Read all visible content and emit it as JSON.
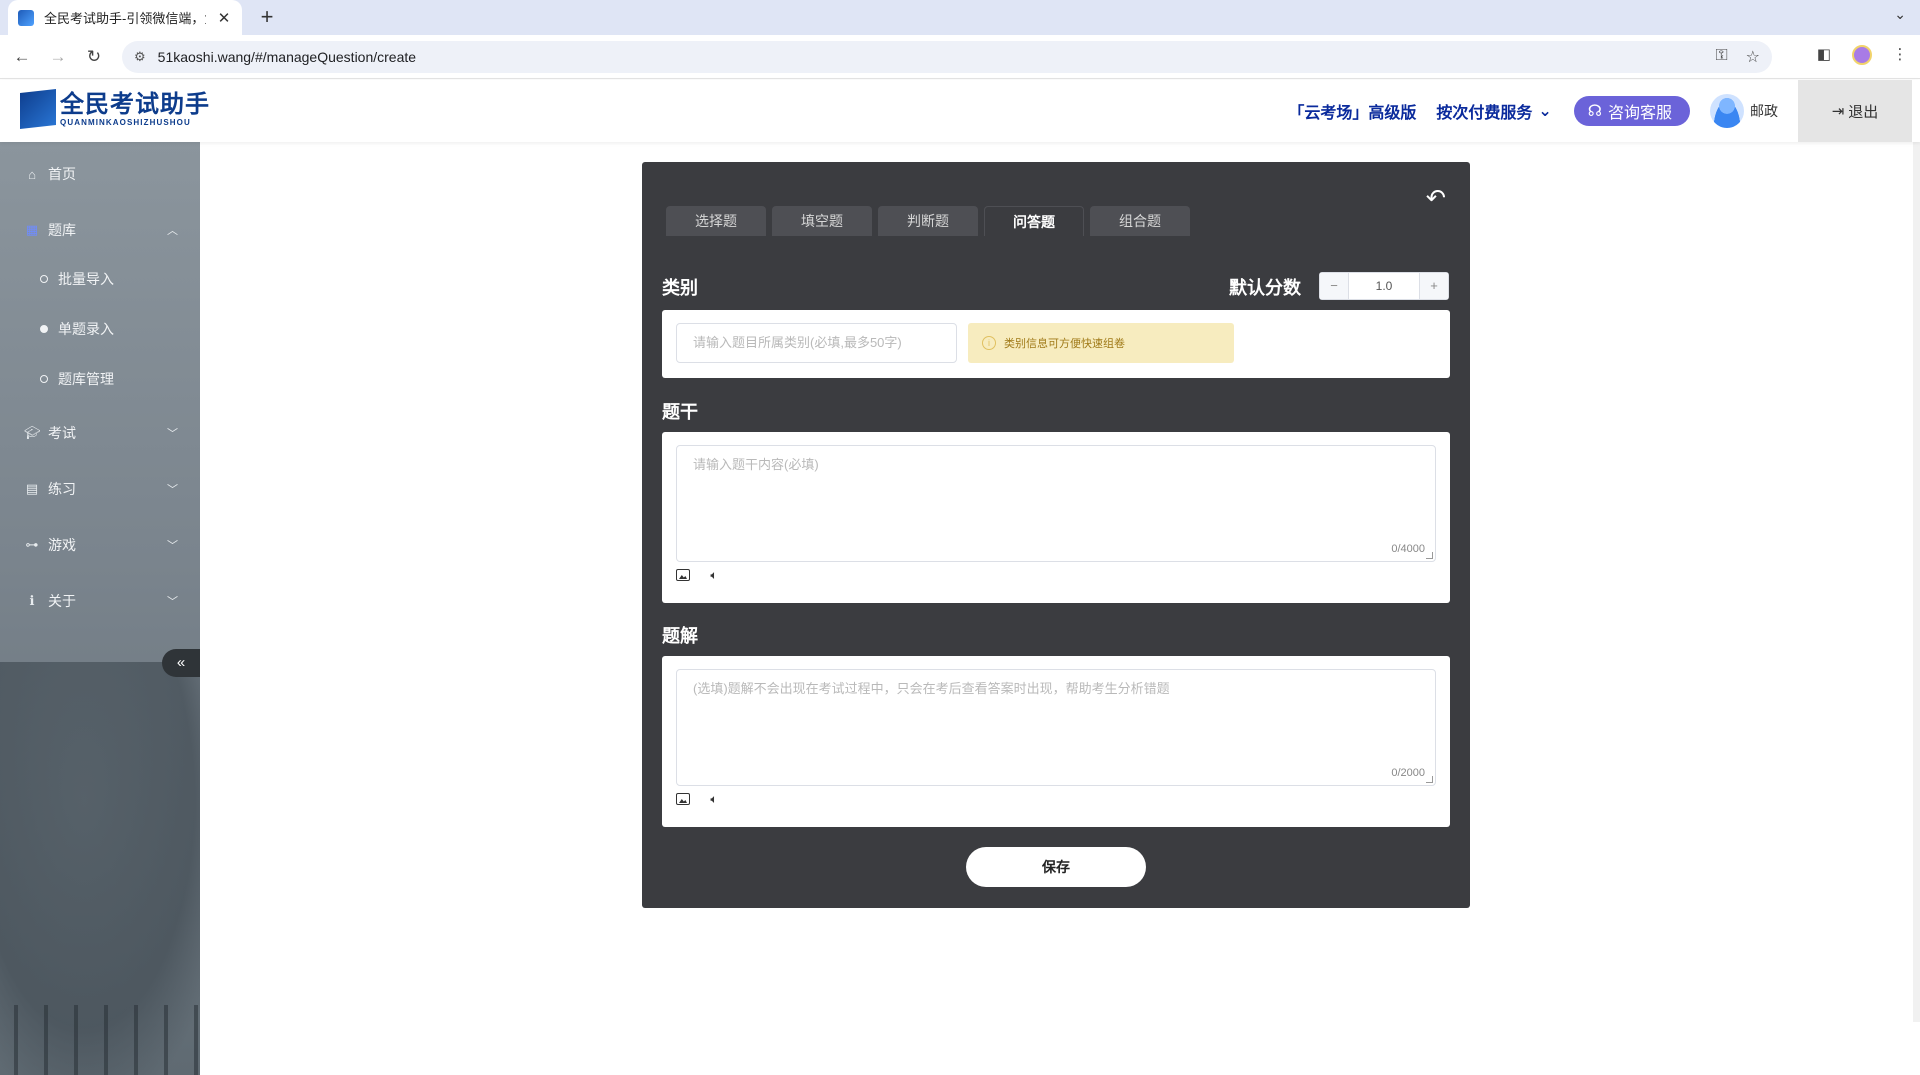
{
  "browser": {
    "tab_title": "全民考试助手-引领微信端，免费",
    "url": "51kaoshi.wang/#/manageQuestion/create"
  },
  "header": {
    "logo_cn": "全民考试助手",
    "logo_en": "QUANMINKAOSHIZHUSHOU",
    "premium": "「云考场」高级版",
    "pay_service": "按次付费服务",
    "consult": "咨询客服",
    "username": "邮政",
    "logout": "退出"
  },
  "sidebar": {
    "home": "首页",
    "bank": "题库",
    "bank_sub": [
      "批量导入",
      "单题录入",
      "题库管理"
    ],
    "exam": "考试",
    "practice": "练习",
    "game": "游戏",
    "about": "关于"
  },
  "editor": {
    "tabs": [
      "选择题",
      "填空题",
      "判断题",
      "问答题",
      "组合题"
    ],
    "active_tab": "问答题",
    "category_label": "类别",
    "score_label": "默认分数",
    "score_value": "1.0",
    "category_placeholder": "请输入题目所属类别(必填,最多50字)",
    "category_tip": "类别信息可方便快速组卷",
    "stem_label": "题干",
    "stem_placeholder": "请输入题干内容(必填)",
    "stem_count": "0/4000",
    "answer_label": "题解",
    "answer_placeholder": "(选填)题解不会出现在考试过程中，只会在考后查看答案时出现，帮助考生分析错题",
    "answer_count": "0/2000",
    "save": "保存"
  },
  "colors": {
    "card_bg": "#3b3c40",
    "consult_bg": "#6b63d9",
    "brand_blue": "#0a2a9c",
    "tip_bg": "#f7ecbf"
  }
}
